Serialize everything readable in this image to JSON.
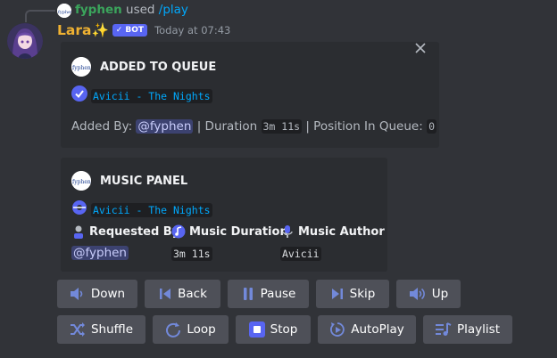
{
  "reply": {
    "user": "fyphen",
    "verb": "used",
    "command": "/play"
  },
  "message": {
    "author": "Lara✨",
    "bot_badge": "✓ BOT",
    "timestamp": "Today at 07:43"
  },
  "embed_queue": {
    "title": "ADDED TO QUEUE",
    "track": "Avicii - The Nights",
    "added_by_label": "Added By:",
    "added_by_user": "@fyphen",
    "duration_label": "| Duration",
    "duration_value": "3m 11s",
    "position_label": "| Position In Queue:",
    "position_value": "0",
    "close_icon": "close-icon"
  },
  "embed_panel": {
    "title": "MUSIC PANEL",
    "track": "Avicii - The Nights",
    "fields": [
      {
        "name": "Requested By",
        "value": "@fyphen",
        "icon": "user-icon"
      },
      {
        "name": "Music Duration",
        "value": "3m 11s",
        "icon": "music-note-icon"
      },
      {
        "name": "Music Author",
        "value": "Avicii",
        "icon": "microphone-icon"
      }
    ]
  },
  "buttons": {
    "row1": [
      {
        "label": "Down",
        "icon": "volume-down-icon"
      },
      {
        "label": "Back",
        "icon": "skip-back-icon"
      },
      {
        "label": "Pause",
        "icon": "pause-icon"
      },
      {
        "label": "Skip",
        "icon": "skip-forward-icon"
      },
      {
        "label": "Up",
        "icon": "volume-up-icon"
      }
    ],
    "row2": [
      {
        "label": "Shuffle",
        "icon": "shuffle-icon"
      },
      {
        "label": "Loop",
        "icon": "loop-icon"
      },
      {
        "label": "Stop",
        "icon": "stop-icon"
      },
      {
        "label": "AutoPlay",
        "icon": "autoplay-icon"
      },
      {
        "label": "Playlist",
        "icon": "playlist-icon"
      }
    ]
  },
  "colors": {
    "background": "#313338",
    "embed": "#2b2d31",
    "button": "#4e5058",
    "accent": "#5865f2",
    "link": "#00a8fc",
    "author": "#f0b232",
    "reply_user": "#3ba55c"
  }
}
